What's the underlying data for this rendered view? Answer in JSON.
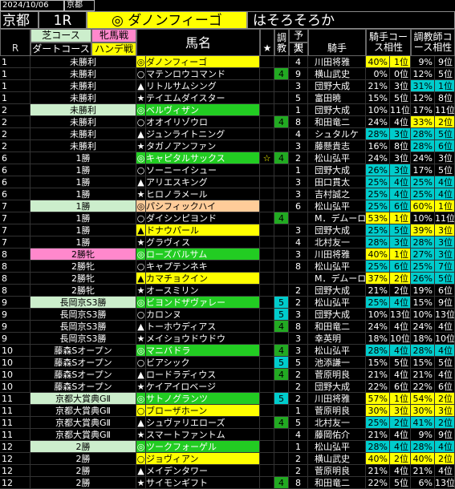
{
  "header": {
    "date": "2024/10/06",
    "course": "京都",
    "track": "京都",
    "race": "1R",
    "horse": "◎ ダノンフィーゴ",
    "comment": "はそろそろか"
  },
  "columns": {
    "r": "R",
    "turf": "芝コース",
    "dirt": "ダートコース",
    "filly": "牝馬戦",
    "handicap": "ハンデ戦",
    "horse_name": "馬名",
    "star": "★",
    "trainer_mark": "調教",
    "pred": "予想",
    "pop": "人気",
    "jockey": "騎手",
    "jockey_course": "騎手コース相性",
    "trainer_course": "調教師コース相性"
  },
  "rows": [
    {
      "r": "1",
      "cls": "未勝利",
      "clsbg": "#000",
      "mark": "◎",
      "name": "ダノンフィーゴ",
      "namebg": "#ffff00",
      "namec": "#000",
      "star": "",
      "tr": "",
      "trbg": "#000",
      "pred": "4",
      "jockey": "川田将雅",
      "jr": "40%",
      "jp": "1位",
      "jbg": "#ffff00",
      "jc": "#000",
      "tr2": "9%",
      "tp": "9位",
      "tbg": "#000",
      "tc": "#fff"
    },
    {
      "r": "1",
      "cls": "未勝利",
      "clsbg": "#000",
      "mark": "○",
      "name": "マテンロウコマンド",
      "namebg": "#000",
      "namec": "#fff",
      "star": "",
      "tr": "4",
      "trbg": "#22aa22",
      "pred": "9",
      "jockey": "横山武史",
      "jr": "0%",
      "jp": "0位",
      "jbg": "#000",
      "jc": "#fff",
      "tr2": "12%",
      "tp": "5位",
      "tbg": "#000",
      "tc": "#fff"
    },
    {
      "r": "1",
      "cls": "未勝利",
      "clsbg": "#000",
      "mark": "▲",
      "name": "リトルサムシング",
      "namebg": "#000",
      "namec": "#fff",
      "star": "",
      "tr": "",
      "trbg": "#000",
      "pred": "3",
      "jockey": "団野大成",
      "jr": "21%",
      "jp": "3位",
      "jbg": "#000",
      "jc": "#fff",
      "tr2": "31%",
      "tp": "1位",
      "tbg": "#00cccc",
      "tc": "#000"
    },
    {
      "r": "1",
      "cls": "未勝利",
      "clsbg": "#000",
      "mark": "★",
      "name": "テイエムダイスター",
      "namebg": "#000",
      "namec": "#fff",
      "star": "",
      "tr": "",
      "trbg": "#000",
      "pred": "5",
      "jockey": "富田暁",
      "jr": "15%",
      "jp": "5位",
      "jbg": "#000",
      "jc": "#fff",
      "tr2": "12%",
      "tp": "8位",
      "tbg": "#000",
      "tc": "#fff"
    },
    {
      "r": "2",
      "cls": "未勝利",
      "clsbg": "#cceecc",
      "mark": "◎",
      "name": "ベルヴィザン",
      "namebg": "#22cc22",
      "namec": "#fff",
      "star": "",
      "tr": "",
      "trbg": "#000",
      "pred": "1",
      "jockey": "団野大成",
      "jr": "10%",
      "jp": "11位",
      "jbg": "#000",
      "jc": "#fff",
      "tr2": "17%",
      "tp": "11位",
      "tbg": "#000",
      "tc": "#fff"
    },
    {
      "r": "2",
      "cls": "未勝利",
      "clsbg": "#000",
      "mark": "○",
      "name": "オオイリゾウロ",
      "namebg": "#000",
      "namec": "#fff",
      "star": "",
      "tr": "4",
      "trbg": "#22aa22",
      "pred": "8",
      "jockey": "和田竜二",
      "jr": "24%",
      "jp": "4位",
      "jbg": "#000",
      "jc": "#fff",
      "tr2": "33%",
      "tp": "2位",
      "tbg": "#ffff00",
      "tc": "#000"
    },
    {
      "r": "2",
      "cls": "未勝利",
      "clsbg": "#000",
      "mark": "▲",
      "name": "ジュンライトニング",
      "namebg": "#000",
      "namec": "#fff",
      "star": "",
      "tr": "",
      "trbg": "#000",
      "pred": "4",
      "jockey": "シュタルケ",
      "jr": "28%",
      "jp": "3位",
      "jbg": "#00cccc",
      "jc": "#000",
      "tr2": "28%",
      "tp": "5位",
      "tbg": "#00cccc",
      "tc": "#000"
    },
    {
      "r": "2",
      "cls": "未勝利",
      "clsbg": "#000",
      "mark": "★",
      "name": "タガノアンファン",
      "namebg": "#000",
      "namec": "#fff",
      "star": "",
      "tr": "",
      "trbg": "#000",
      "pred": "3",
      "jockey": "藤懸貴志",
      "jr": "16%",
      "jp": "8位",
      "jbg": "#000",
      "jc": "#fff",
      "tr2": "28%",
      "tp": "6位",
      "tbg": "#00cccc",
      "tc": "#000"
    },
    {
      "r": "6",
      "cls": "1勝",
      "clsbg": "#000",
      "mark": "◎",
      "name": "キャピタルサックス",
      "namebg": "#22cc22",
      "namec": "#fff",
      "star": "☆",
      "tr": "4",
      "trbg": "#22aa22",
      "pred": "2",
      "jockey": "松山弘平",
      "jr": "24%",
      "jp": "3位",
      "jbg": "#000",
      "jc": "#fff",
      "tr2": "24%",
      "tp": "3位",
      "tbg": "#000",
      "tc": "#fff"
    },
    {
      "r": "6",
      "cls": "1勝",
      "clsbg": "#000",
      "mark": "○",
      "name": "ソーニーイシュー",
      "namebg": "#000",
      "namec": "#fff",
      "star": "",
      "tr": "",
      "trbg": "#000",
      "pred": "1",
      "jockey": "団野大成",
      "jr": "26%",
      "jp": "3位",
      "jbg": "#00cccc",
      "jc": "#000",
      "tr2": "17%",
      "tp": "5位",
      "tbg": "#000",
      "tc": "#fff"
    },
    {
      "r": "6",
      "cls": "1勝",
      "clsbg": "#000",
      "mark": "▲",
      "name": "アリエスキング",
      "namebg": "#000",
      "namec": "#fff",
      "star": "",
      "tr": "",
      "trbg": "#000",
      "pred": "3",
      "jockey": "田口貫太",
      "jr": "25%",
      "jp": "4位",
      "jbg": "#00cccc",
      "jc": "#000",
      "tr2": "25%",
      "tp": "4位",
      "tbg": "#00cccc",
      "tc": "#000"
    },
    {
      "r": "6",
      "cls": "1勝",
      "clsbg": "#000",
      "mark": "★",
      "name": "ヒロノラメール",
      "namebg": "#000",
      "namec": "#fff",
      "star": "",
      "tr": "",
      "trbg": "#000",
      "pred": "3",
      "jockey": "吉村誠之",
      "jr": "25%",
      "jp": "4位",
      "jbg": "#00cccc",
      "jc": "#000",
      "tr2": "25%",
      "tp": "4位",
      "tbg": "#00cccc",
      "tc": "#000"
    },
    {
      "r": "7",
      "cls": "1勝",
      "clsbg": "#cceecc",
      "mark": "◎",
      "name": "パシフィックハイ",
      "namebg": "#ffcc99",
      "namec": "#000",
      "star": "",
      "tr": "",
      "trbg": "#000",
      "pred": "6",
      "jockey": "松山弘平",
      "jr": "25%",
      "jp": "6位",
      "jbg": "#00cccc",
      "jc": "#000",
      "tr2": "60%",
      "tp": "1位",
      "tbg": "#ffff00",
      "tc": "#000"
    },
    {
      "r": "7",
      "cls": "1勝",
      "clsbg": "#000",
      "mark": "○",
      "name": "ダイシンピヨンド",
      "namebg": "#000",
      "namec": "#fff",
      "star": "",
      "tr": "4",
      "trbg": "#22aa22",
      "pred": "",
      "jockey": "M．デムーロ",
      "jr": "53%",
      "jp": "1位",
      "jbg": "#ffff00",
      "jc": "#000",
      "tr2": "10%",
      "tp": "11位",
      "tbg": "#000",
      "tc": "#fff"
    },
    {
      "r": "7",
      "cls": "1勝",
      "clsbg": "#000",
      "mark": "▲",
      "name": "ドナウパール",
      "namebg": "#ffff00",
      "namec": "#000",
      "star": "",
      "tr": "",
      "trbg": "#000",
      "pred": "3",
      "jockey": "団野大成",
      "jr": "25%",
      "jp": "5位",
      "jbg": "#00cccc",
      "jc": "#000",
      "tr2": "39%",
      "tp": "3位",
      "tbg": "#ffff00",
      "tc": "#000"
    },
    {
      "r": "7",
      "cls": "1勝",
      "clsbg": "#000",
      "mark": "★",
      "name": "グラヴィス",
      "namebg": "#000",
      "namec": "#fff",
      "star": "",
      "tr": "",
      "trbg": "#000",
      "pred": "4",
      "jockey": "北村友一",
      "jr": "28%",
      "jp": "3位",
      "jbg": "#00cccc",
      "jc": "#000",
      "tr2": "28%",
      "tp": "3位",
      "tbg": "#00cccc",
      "tc": "#000"
    },
    {
      "r": "8",
      "cls": "2勝牝",
      "clsbg": "#ff88cc",
      "mark": "◎",
      "name": "ローズバルサム",
      "namebg": "#22cc22",
      "namec": "#fff",
      "star": "",
      "tr": "",
      "trbg": "#000",
      "pred": "3",
      "jockey": "川田将雅",
      "jr": "40%",
      "jp": "1位",
      "jbg": "#ffff00",
      "jc": "#000",
      "tr2": "27%",
      "tp": "3位",
      "tbg": "#00cccc",
      "tc": "#000"
    },
    {
      "r": "8",
      "cls": "2勝牝",
      "clsbg": "#000",
      "mark": "○",
      "name": "キャプテンネキ",
      "namebg": "#000",
      "namec": "#fff",
      "star": "",
      "tr": "",
      "trbg": "#000",
      "pred": "8",
      "jockey": "松山弘平",
      "jr": "25%",
      "jp": "6位",
      "jbg": "#00cccc",
      "jc": "#000",
      "tr2": "25%",
      "tp": "7位",
      "tbg": "#00cccc",
      "tc": "#000"
    },
    {
      "r": "8",
      "cls": "2勝牝",
      "clsbg": "#000",
      "mark": "▲",
      "name": "カマチョクイン",
      "namebg": "#ffff00",
      "namec": "#000",
      "star": "",
      "tr": "",
      "trbg": "#000",
      "pred": "",
      "jockey": "M．デムーロ",
      "jr": "37%",
      "jp": "2位",
      "jbg": "#ffff00",
      "jc": "#000",
      "tr2": "26%",
      "tp": "5位",
      "tbg": "#00cccc",
      "tc": "#000"
    },
    {
      "r": "8",
      "cls": "2勝牝",
      "clsbg": "#000",
      "mark": "★",
      "name": "オースミリン",
      "namebg": "#000",
      "namec": "#fff",
      "star": "",
      "tr": "",
      "trbg": "#000",
      "pred": "2",
      "jockey": "団野大成",
      "jr": "21%",
      "jp": "2位",
      "jbg": "#000",
      "jc": "#fff",
      "tr2": "19%",
      "tp": "6位",
      "tbg": "#000",
      "tc": "#fff"
    },
    {
      "r": "9",
      "cls": "長岡京S3勝",
      "clsbg": "#cceecc",
      "mark": "◎",
      "name": "ビヨンドザヴァレー",
      "namebg": "#22cc22",
      "namec": "#fff",
      "star": "",
      "tr": "5",
      "trbg": "#00cccc",
      "pred": "2",
      "jockey": "松山弘平",
      "jr": "25%",
      "jp": "4位",
      "jbg": "#00cccc",
      "jc": "#000",
      "tr2": "15%",
      "tp": "9位",
      "tbg": "#000",
      "tc": "#fff"
    },
    {
      "r": "9",
      "cls": "長岡京S3勝",
      "clsbg": "#000",
      "mark": "○",
      "name": "カロンヌ",
      "namebg": "#000",
      "namec": "#fff",
      "star": "",
      "tr": "5",
      "trbg": "#00cccc",
      "pred": "3",
      "jockey": "団野大成",
      "jr": "10%",
      "jp": "13位",
      "jbg": "#000",
      "jc": "#fff",
      "tr2": "10%",
      "tp": "13位",
      "tbg": "#000",
      "tc": "#fff"
    },
    {
      "r": "9",
      "cls": "長岡京S3勝",
      "clsbg": "#000",
      "mark": "▲",
      "name": "トーホウディアス",
      "namebg": "#000",
      "namec": "#fff",
      "star": "",
      "tr": "4",
      "trbg": "#22aa22",
      "pred": "8",
      "jockey": "和田竜二",
      "jr": "24%",
      "jp": "4位",
      "jbg": "#000",
      "jc": "#fff",
      "tr2": "24%",
      "tp": "4位",
      "tbg": "#000",
      "tc": "#fff"
    },
    {
      "r": "9",
      "cls": "長岡京S3勝",
      "clsbg": "#000",
      "mark": "★",
      "name": "メイショウドウドウ",
      "namebg": "#000",
      "namec": "#fff",
      "star": "",
      "tr": "",
      "trbg": "#000",
      "pred": "3",
      "jockey": "幸英明",
      "jr": "18%",
      "jp": "10位",
      "jbg": "#000",
      "jc": "#fff",
      "tr2": "18%",
      "tp": "10位",
      "tbg": "#000",
      "tc": "#fff"
    },
    {
      "r": "10",
      "cls": "藤森Sオープン",
      "clsbg": "#000",
      "mark": "◎",
      "name": "マニバドラ",
      "namebg": "#22cc22",
      "namec": "#fff",
      "star": "",
      "tr": "4",
      "trbg": "#22aa22",
      "pred": "3",
      "jockey": "松山弘平",
      "jr": "28%",
      "jp": "4位",
      "jbg": "#00cccc",
      "jc": "#000",
      "tr2": "28%",
      "tp": "4位",
      "tbg": "#00cccc",
      "tc": "#000"
    },
    {
      "r": "10",
      "cls": "藤森Sオープン",
      "clsbg": "#000",
      "mark": "○",
      "name": "ビアシック",
      "namebg": "#000",
      "namec": "#fff",
      "star": "",
      "tr": "5",
      "trbg": "#00cccc",
      "pred": "5",
      "jockey": "池添謙一",
      "jr": "15%",
      "jp": "5位",
      "jbg": "#000",
      "jc": "#fff",
      "tr2": "15%",
      "tp": "5位",
      "tbg": "#000",
      "tc": "#fff"
    },
    {
      "r": "10",
      "cls": "藤森Sオープン",
      "clsbg": "#000",
      "mark": "▲",
      "name": "ロードラディウス",
      "namebg": "#000",
      "namec": "#fff",
      "star": "",
      "tr": "4",
      "trbg": "#22aa22",
      "pred": "2",
      "jockey": "菅原明良",
      "jr": "21%",
      "jp": "4位",
      "jbg": "#000",
      "jc": "#fff",
      "tr2": "21%",
      "tp": "4位",
      "tbg": "#000",
      "tc": "#fff"
    },
    {
      "r": "10",
      "cls": "藤森Sオープン",
      "clsbg": "#000",
      "mark": "★",
      "name": "ケイアイロベージ",
      "namebg": "#000",
      "namec": "#fff",
      "star": "",
      "tr": "",
      "trbg": "#000",
      "pred": "2",
      "jockey": "団野大成",
      "jr": "22%",
      "jp": "6位",
      "jbg": "#000",
      "jc": "#fff",
      "tr2": "22%",
      "tp": "6位",
      "tbg": "#000",
      "tc": "#fff"
    },
    {
      "r": "11",
      "cls": "京都大賞典GⅡ",
      "clsbg": "#cceecc",
      "mark": "◎",
      "name": "サトノグランツ",
      "namebg": "#22cc22",
      "namec": "#fff",
      "star": "",
      "tr": "5",
      "trbg": "#00cccc",
      "pred": "2",
      "jockey": "川田将雅",
      "jr": "57%",
      "jp": "1位",
      "jbg": "#ffff00",
      "jc": "#000",
      "tr2": "54%",
      "tp": "2位",
      "tbg": "#ffff00",
      "tc": "#000"
    },
    {
      "r": "11",
      "cls": "京都大賞典GⅡ",
      "clsbg": "#000",
      "mark": "○",
      "name": "ブローザホーン",
      "namebg": "#ffff00",
      "namec": "#000",
      "star": "",
      "tr": "",
      "trbg": "#000",
      "pred": "1",
      "jockey": "菅原明良",
      "jr": "30%",
      "jp": "3位",
      "jbg": "#ffff00",
      "jc": "#000",
      "tr2": "30%",
      "tp": "3位",
      "tbg": "#ffff00",
      "tc": "#000"
    },
    {
      "r": "11",
      "cls": "京都大賞典GⅡ",
      "clsbg": "#000",
      "mark": "▲",
      "name": "シュヴァリエローズ",
      "namebg": "#000",
      "namec": "#fff",
      "star": "",
      "tr": "4",
      "trbg": "#22aa22",
      "pred": "5",
      "jockey": "北村友一",
      "jr": "25%",
      "jp": "2位",
      "jbg": "#00cccc",
      "jc": "#000",
      "tr2": "41%",
      "tp": "2位",
      "tbg": "#00cccc",
      "tc": "#000"
    },
    {
      "r": "11",
      "cls": "京都大賞典GⅡ",
      "clsbg": "#000",
      "mark": "★",
      "name": "スマートファントム",
      "namebg": "#000",
      "namec": "#fff",
      "star": "",
      "tr": "",
      "trbg": "#000",
      "pred": "4",
      "jockey": "藤岡佑介",
      "jr": "21%",
      "jp": "4位",
      "jbg": "#000",
      "jc": "#fff",
      "tr2": "9%",
      "tp": "9位",
      "tbg": "#000",
      "tc": "#fff"
    },
    {
      "r": "12",
      "cls": "2勝",
      "clsbg": "#cceecc",
      "mark": "◎",
      "name": "ツークフォーゲル",
      "namebg": "#22cc22",
      "namec": "#fff",
      "star": "",
      "tr": "",
      "trbg": "#000",
      "pred": "1",
      "jockey": "松山弘平",
      "jr": "28%",
      "jp": "4位",
      "jbg": "#00cccc",
      "jc": "#000",
      "tr2": "28%",
      "tp": "4位",
      "tbg": "#00cccc",
      "tc": "#000"
    },
    {
      "r": "12",
      "cls": "2勝",
      "clsbg": "#000",
      "mark": "○",
      "name": "ジョヴィアン",
      "namebg": "#ffff00",
      "namec": "#000",
      "star": "",
      "tr": "",
      "trbg": "#000",
      "pred": "2",
      "jockey": "横山武史",
      "jr": "40%",
      "jp": "2位",
      "jbg": "#ffff00",
      "jc": "#000",
      "tr2": "40%",
      "tp": "2位",
      "tbg": "#ffff00",
      "tc": "#000"
    },
    {
      "r": "12",
      "cls": "2勝",
      "clsbg": "#000",
      "mark": "▲",
      "name": "メイデンタワー",
      "namebg": "#000",
      "namec": "#fff",
      "star": "",
      "tr": "",
      "trbg": "#000",
      "pred": "2",
      "jockey": "菅原明良",
      "jr": "21%",
      "jp": "4位",
      "jbg": "#000",
      "jc": "#fff",
      "tr2": "21%",
      "tp": "4位",
      "tbg": "#000",
      "tc": "#fff"
    },
    {
      "r": "12",
      "cls": "2勝",
      "clsbg": "#000",
      "mark": "★",
      "name": "サイモンギフト",
      "namebg": "#000",
      "namec": "#fff",
      "star": "",
      "tr": "4",
      "trbg": "#22aa22",
      "pred": "8",
      "jockey": "和田竜二",
      "jr": "22%",
      "jp": "5位",
      "jbg": "#000",
      "jc": "#fff",
      "tr2": "6%",
      "tp": "13位",
      "tbg": "#000",
      "tc": "#fff"
    }
  ]
}
